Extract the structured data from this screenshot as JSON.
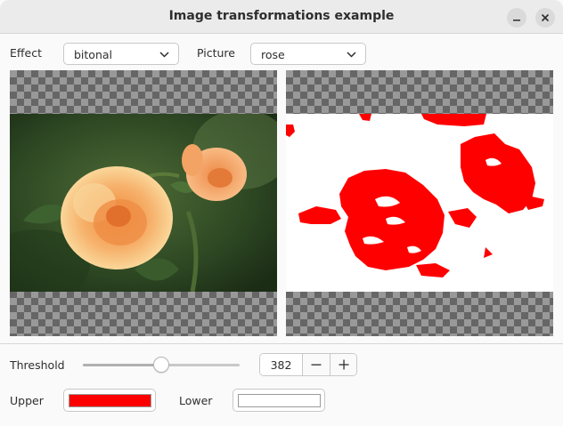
{
  "window": {
    "title": "Image transformations example"
  },
  "controls": {
    "effect_label": "Effect",
    "effect_value": "bitonal",
    "picture_label": "Picture",
    "picture_value": "rose"
  },
  "threshold": {
    "label": "Threshold",
    "value": "382",
    "fraction": 0.5
  },
  "colors": {
    "upper_label": "Upper",
    "upper_color": "#ff0000",
    "lower_label": "Lower",
    "lower_color": "#ffffff"
  },
  "icons": [
    "minimize-icon",
    "close-icon",
    "chevron-down-icon",
    "minus-icon",
    "plus-icon"
  ]
}
